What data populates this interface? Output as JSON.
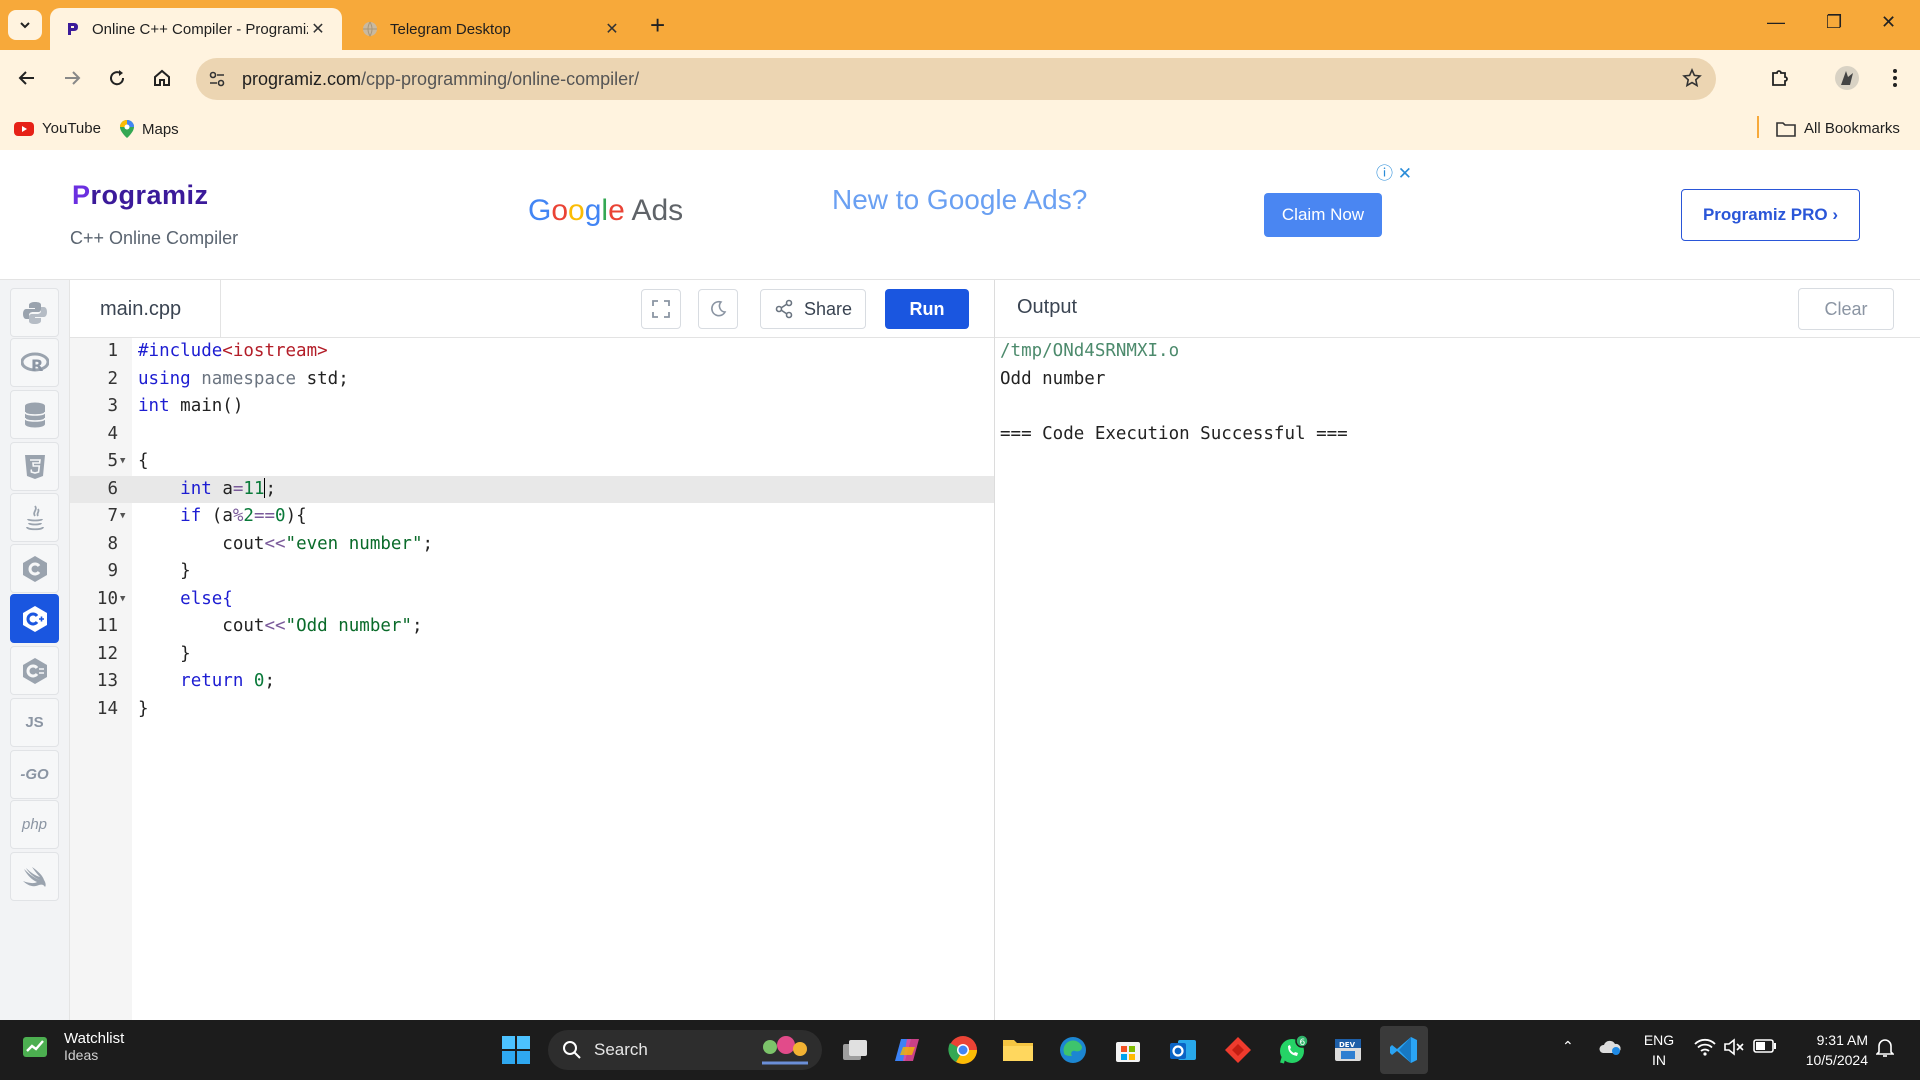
{
  "browser": {
    "tabs": [
      {
        "title": "Online C++ Compiler - Programiz",
        "active": true
      },
      {
        "title": "Telegram Desktop",
        "active": false
      }
    ],
    "url_host": "programiz.com",
    "url_path": "/cpp-programming/online-compiler/",
    "bookmarks": [
      "YouTube",
      "Maps"
    ],
    "all_bookmarks": "All Bookmarks",
    "accent": "#f7a93a"
  },
  "header": {
    "logo": "rogramiz",
    "logo_p": "P",
    "subtitle": "C++ Online Compiler",
    "ad_brand_google": [
      "G",
      "o",
      "o",
      "g",
      "l",
      "e"
    ],
    "ad_brand_ads": "Ads",
    "ad_headline": "New to Google Ads?",
    "ad_cta": "Claim Now",
    "pro_button": "Programiz PRO ›"
  },
  "rail": {
    "languages": [
      "python-icon",
      "r-icon",
      "sql-icon",
      "html-icon",
      "java-icon",
      "c-icon",
      "cpp-icon",
      "csharp-icon",
      "JS",
      "GO",
      "php",
      "swift-icon"
    ],
    "labels": {
      "js": "JS",
      "go": "-GO",
      "php": "php"
    }
  },
  "editor": {
    "file_name": "main.cpp",
    "share_label": "Share",
    "run_label": "Run",
    "lines": [
      "1",
      "2",
      "3",
      "4",
      "5",
      "6",
      "7",
      "8",
      "9",
      "10",
      "11",
      "12",
      "13",
      "14"
    ],
    "code": {
      "l1_pp": "#include",
      "l1_inc": "<iostream>",
      "l2_kw": "using",
      "l2_ns": "namespace",
      "l2_rest": "std;",
      "l3_kw": "int",
      "l3_rest": "main()",
      "l5": "{",
      "l6_kw": "int",
      "l6_a": "a",
      "l6_eq": "=",
      "l6_num": "11",
      "l6_end": ";",
      "l7_kw": "if",
      "l7_a": "(a",
      "l7_op": "%",
      "l7_num": "2",
      "l7_eq": "==",
      "l7_zero": "0",
      "l7_end": "){",
      "l8_cout": "cout",
      "l8_op": "<<",
      "l8_str": "\"even number\"",
      "l8_end": ";",
      "l9": "}",
      "l10": "else{",
      "l11_cout": "cout",
      "l11_op": "<<",
      "l11_str": "\"Odd number\"",
      "l11_end": ";",
      "l12": "}",
      "l13_kw": "return",
      "l13_num": "0",
      "l13_end": ";",
      "l14": "}"
    }
  },
  "output": {
    "title": "Output",
    "clear_label": "Clear",
    "lines": [
      "/tmp/ONd4SRNMXI.o",
      "Odd number",
      "",
      "=== Code Execution Successful ==="
    ]
  },
  "taskbar": {
    "widget_title": "Watchlist",
    "widget_sub": "Ideas",
    "search_label": "Search",
    "lang_top": "ENG",
    "lang_bottom": "IN",
    "time": "9:31 AM",
    "date": "10/5/2024",
    "whatsapp_badge": "6"
  }
}
